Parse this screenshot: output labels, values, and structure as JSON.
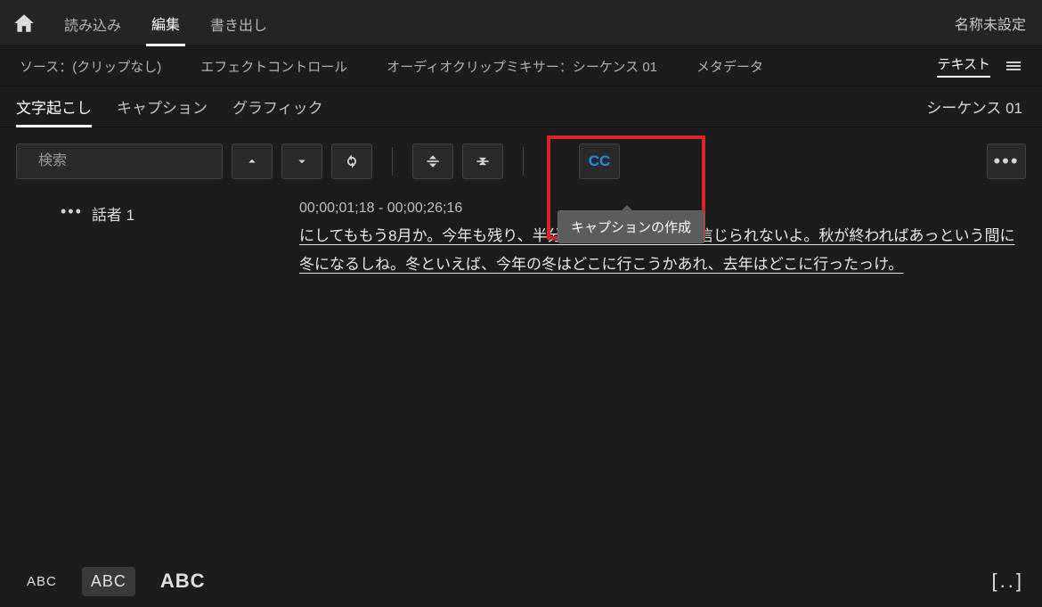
{
  "top": {
    "modes": [
      "読み込み",
      "編集",
      "書き出し"
    ],
    "active_mode": "編集",
    "project_name": "名称未設定"
  },
  "panel_tabs": {
    "items": [
      "ソース：(クリップなし)",
      "エフェクトコントロール",
      "オーディオクリップミキサー：シーケンス 01",
      "メタデータ",
      "テキスト"
    ],
    "active": "テキスト"
  },
  "sub_tabs": {
    "items": [
      "文字起こし",
      "キャプション",
      "グラフィック"
    ],
    "active": "文字起こし",
    "sequence_name": "シーケンス 01"
  },
  "toolbar": {
    "search_placeholder": "検索",
    "cc_label": "CC",
    "tooltip": "キャプションの作成",
    "more_label": "•••"
  },
  "transcript": {
    "segments": [
      {
        "speaker": "話者 1",
        "time_in": "00;00;01;18",
        "time_out": "00;00;26;16",
        "text": "にしてももう8月か。今年も残り、半分過ぎちゃったなんて信じられないよ。秋が終わればあっという間に冬になるしね。冬といえば、今年の冬はどこに行こうかあれ、去年はどこに行ったっけ。"
      }
    ]
  },
  "footer": {
    "size_small": "ABC",
    "size_medium": "ABC",
    "size_large": "ABC",
    "bracket": "[..]"
  }
}
